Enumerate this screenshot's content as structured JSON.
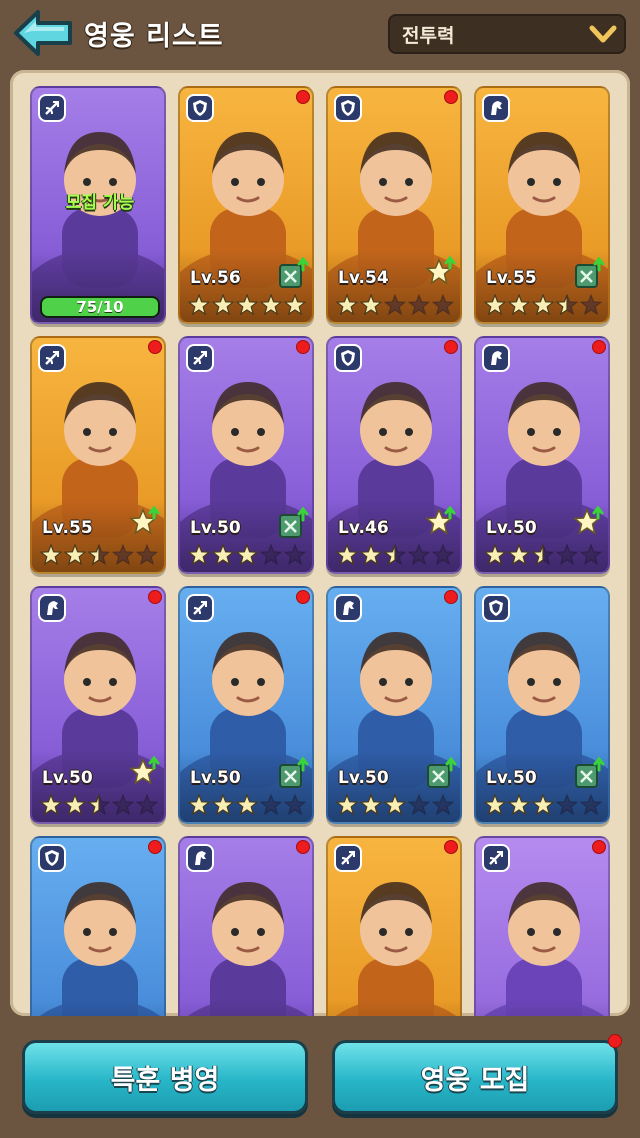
{
  "header": {
    "title": "영웅 리스트",
    "sort_value": "전투력"
  },
  "colors": {
    "background": "#6b5440",
    "panel": "#eadbbe",
    "button": "#27b6c8",
    "new_dot": "#ee1c1c"
  },
  "heroes": [
    {
      "frame": "purple",
      "class_icon": "crossbow-icon",
      "new": false,
      "recruit_label": "모집 가능",
      "progress_label": "75/10",
      "progress": 1.0
    },
    {
      "frame": "orange",
      "class_icon": "shield-icon",
      "new": true,
      "level": "Lv.56",
      "stars": 5,
      "upgrade_icon": "book-upgrade-icon"
    },
    {
      "frame": "orange",
      "class_icon": "shield-icon",
      "new": true,
      "level": "Lv.54",
      "stars": 2,
      "upgrade_icon": "star-upgrade-icon"
    },
    {
      "frame": "orange",
      "class_icon": "horse-icon",
      "new": false,
      "level": "Lv.55",
      "stars": 3.5,
      "upgrade_icon": "book-upgrade-icon"
    },
    {
      "frame": "orange",
      "class_icon": "crossbow-icon",
      "new": true,
      "level": "Lv.55",
      "stars": 2.5,
      "upgrade_icon": "star-upgrade-icon"
    },
    {
      "frame": "purple",
      "class_icon": "crossbow-icon",
      "new": true,
      "level": "Lv.50",
      "stars": 3,
      "upgrade_icon": "book-upgrade-icon"
    },
    {
      "frame": "purple",
      "class_icon": "shield-icon",
      "new": true,
      "level": "Lv.46",
      "stars": 2.5,
      "upgrade_icon": "star-upgrade-icon"
    },
    {
      "frame": "purple",
      "class_icon": "horse-icon",
      "new": true,
      "level": "Lv.50",
      "stars": 2.5,
      "upgrade_icon": "star-upgrade-icon"
    },
    {
      "frame": "purple",
      "class_icon": "horse-icon",
      "new": true,
      "level": "Lv.50",
      "stars": 2.5,
      "upgrade_icon": "star-upgrade-icon"
    },
    {
      "frame": "blue",
      "class_icon": "crossbow-icon",
      "new": true,
      "level": "Lv.50",
      "stars": 3,
      "upgrade_icon": "book-upgrade-icon"
    },
    {
      "frame": "blue",
      "class_icon": "horse-icon",
      "new": true,
      "level": "Lv.50",
      "stars": 3,
      "upgrade_icon": "book-upgrade-icon"
    },
    {
      "frame": "blue",
      "class_icon": "shield-icon",
      "new": false,
      "level": "Lv.50",
      "stars": 3,
      "upgrade_icon": "book-upgrade-icon"
    },
    {
      "frame": "blue",
      "class_icon": "shield-icon",
      "new": true
    },
    {
      "frame": "purple",
      "class_icon": "horse-icon",
      "new": true
    },
    {
      "frame": "orange",
      "class_icon": "crossbow-icon",
      "new": true
    },
    {
      "frame": "lavender",
      "class_icon": "crossbow-icon",
      "new": true
    }
  ],
  "buttons": {
    "left_label": "특훈 병영",
    "right_label": "영웅 모집"
  }
}
